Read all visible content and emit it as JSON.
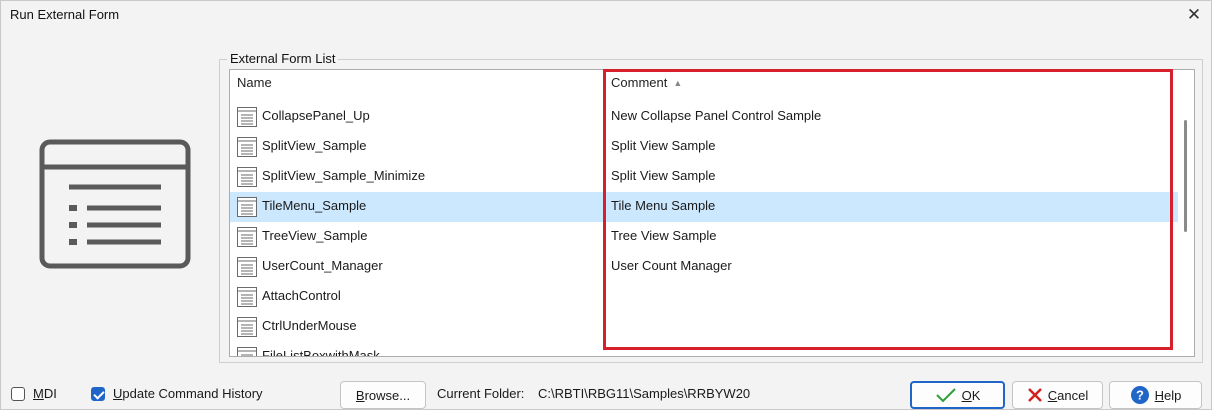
{
  "window": {
    "title": "Run External Form",
    "close_glyph": "✕"
  },
  "group": {
    "label": "External Form List"
  },
  "list": {
    "columns": {
      "name": "Name",
      "comment": "Comment",
      "sort_indicator": "▲"
    },
    "rows": [
      {
        "name": "CollapsePanel_Up",
        "comment": "New Collapse Panel Control Sample",
        "selected": false
      },
      {
        "name": "SplitView_Sample",
        "comment": "Split View Sample",
        "selected": false
      },
      {
        "name": "SplitView_Sample_Minimize",
        "comment": "Split View Sample",
        "selected": false
      },
      {
        "name": "TileMenu_Sample",
        "comment": "Tile Menu Sample",
        "selected": true
      },
      {
        "name": "TreeView_Sample",
        "comment": "Tree View Sample",
        "selected": false
      },
      {
        "name": "UserCount_Manager",
        "comment": "User Count Manager",
        "selected": false
      },
      {
        "name": "AttachControl",
        "comment": "",
        "selected": false
      },
      {
        "name": "CtrlUnderMouse",
        "comment": "",
        "selected": false
      },
      {
        "name": "FileListBoxwithMask",
        "comment": "",
        "selected": false
      }
    ],
    "row_icon": "form-document-icon",
    "selected_color": "#cce8ff"
  },
  "options": {
    "mdi": {
      "label_first": "M",
      "label_rest": "DI",
      "checked": false
    },
    "update_history": {
      "label_first": "U",
      "label_rest": "pdate Command History",
      "checked": true
    }
  },
  "browse": {
    "label_first": "B",
    "label_rest": "rowse..."
  },
  "folder": {
    "label": "Current Folder:",
    "value": "C:\\RBTI\\RBG11\\Samples\\RRBYW20"
  },
  "buttons": {
    "ok": {
      "label_first": "O",
      "label_rest": "K"
    },
    "cancel": {
      "label_first": "C",
      "label_rest": "ancel"
    },
    "help": {
      "label_first": "H",
      "label_rest": "elp"
    }
  },
  "colors": {
    "accent": "#1f66c8",
    "highlight_border": "#d6202c",
    "ok_check": "#2e9e3c",
    "cancel_x": "#d42020"
  }
}
